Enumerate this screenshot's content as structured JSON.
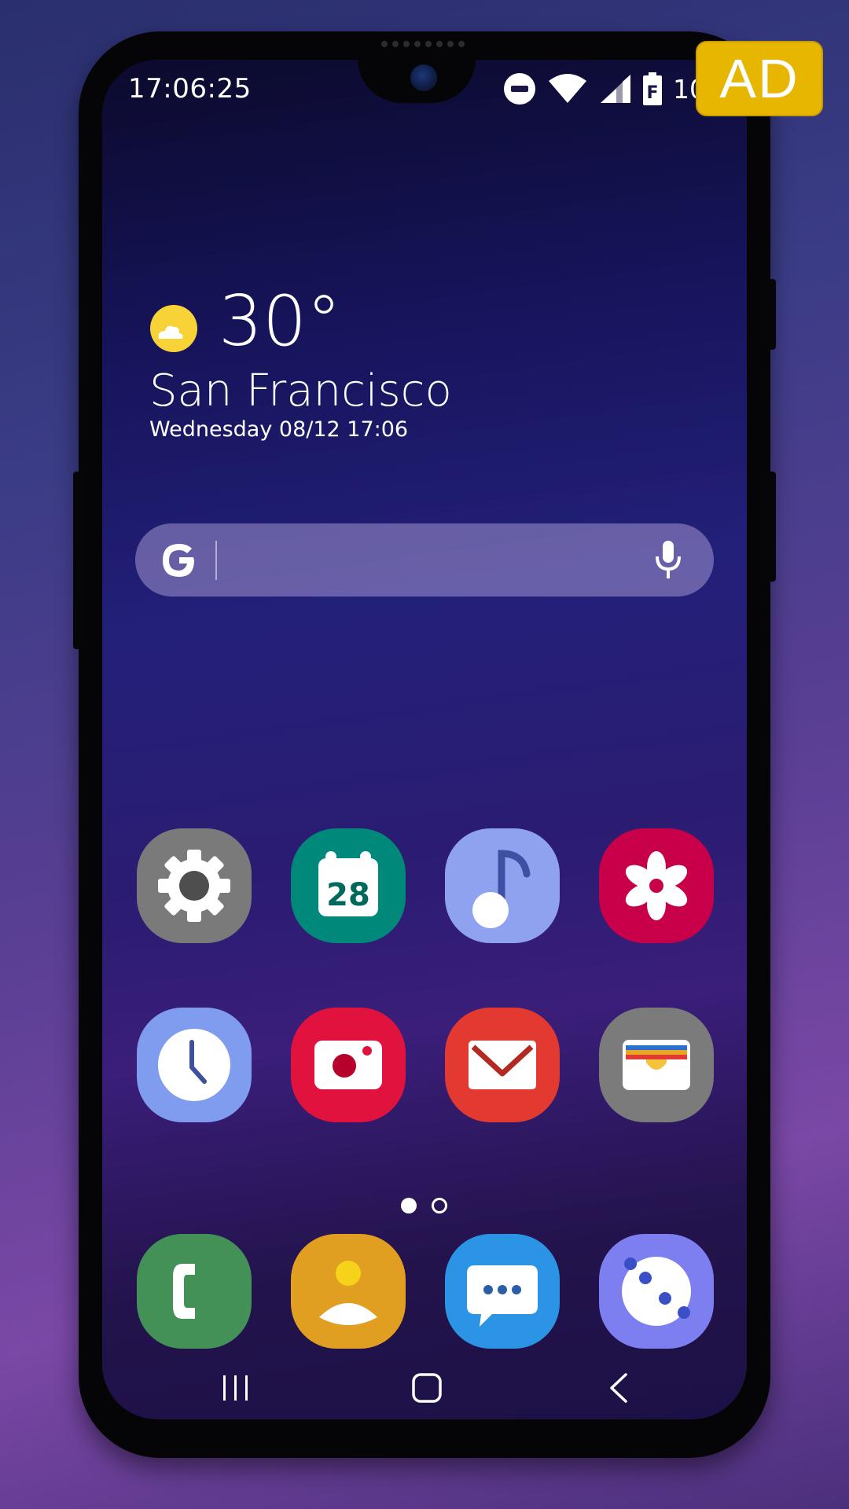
{
  "status_bar": {
    "time": "17:06:25",
    "battery_level": "100",
    "icons": [
      "do-not-disturb-icon",
      "wifi-icon",
      "signal-icon",
      "battery-icon"
    ]
  },
  "weather": {
    "temperature": "30°",
    "city": "San Francisco",
    "datetime": "Wednesday 08/12 17:06",
    "icon": "partly-sunny-icon"
  },
  "search_bar": {
    "logo": "G",
    "icon": "microphone-icon"
  },
  "apps_row1": [
    {
      "name": "settings",
      "icon": "gear-icon",
      "color": "#7a7a7a"
    },
    {
      "name": "calendar",
      "icon": "calendar-icon",
      "color": "#00897b",
      "day": "28"
    },
    {
      "name": "music",
      "icon": "music-note-icon",
      "color": "#8fa2ef"
    },
    {
      "name": "gallery",
      "icon": "flower-icon",
      "color": "#c8004a"
    }
  ],
  "apps_row2": [
    {
      "name": "clock",
      "icon": "clock-icon",
      "color": "#7f9cef"
    },
    {
      "name": "camera",
      "icon": "camera-icon",
      "color": "#e2123f"
    },
    {
      "name": "email",
      "icon": "envelope-icon",
      "color": "#e23a30"
    },
    {
      "name": "wallet",
      "icon": "wallet-icon",
      "color": "#7b7b7b"
    }
  ],
  "dock": [
    {
      "name": "phone",
      "icon": "phone-icon",
      "color": "#449158"
    },
    {
      "name": "contacts",
      "icon": "contact-icon",
      "color": "#e19f22"
    },
    {
      "name": "messages",
      "icon": "chat-bubble-icon",
      "color": "#2b94e4"
    },
    {
      "name": "galaxy-apps",
      "icon": "galaxy-icon",
      "color": "#7d7ef0"
    }
  ],
  "pager": {
    "pages": 2,
    "current": 1
  },
  "nav_bar": [
    "recents-icon",
    "home-icon",
    "back-icon"
  ],
  "ad_badge": "AD",
  "colors": {
    "wallpaper_top": "#0b0a2c",
    "wallpaper_bottom": "#3a1e7a",
    "weather_sun": "#f8d338",
    "ad_badge": "#e6b600"
  }
}
